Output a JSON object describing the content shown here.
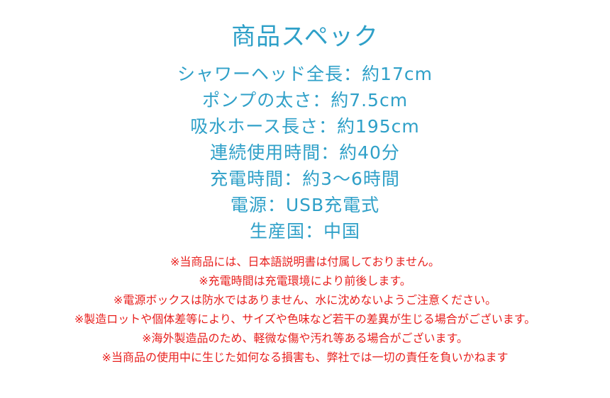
{
  "colors": {
    "heading": "#2fa0c8",
    "spec_text": "#2fa0c8",
    "note_text": "#e8201e",
    "background": "#ffffff"
  },
  "title": "商品スペック",
  "specs": [
    "シャワーヘッド全長：約17cm",
    "ポンプの太さ：約7.5cm",
    "吸水ホース長さ：約195cm",
    "連続使用時間：約40分",
    "充電時間：約3〜6時間",
    "電源：USB充電式",
    "生産国：中国"
  ],
  "notes": [
    "※当商品には、日本語説明書は付属しておりません。",
    "※充電時間は充電環境により前後します。",
    "※電源ボックスは防水ではありません、水に沈めないようご注意ください。",
    "※製造ロットや個体差等により、サイズや色味など若干の差異が生じる場合がございます。",
    "※海外製造品のため、軽微な傷や汚れ等ある場合がございます。",
    "※当商品の使用中に生じた如何なる損害も、弊社では一切の責任を負いかねます"
  ]
}
